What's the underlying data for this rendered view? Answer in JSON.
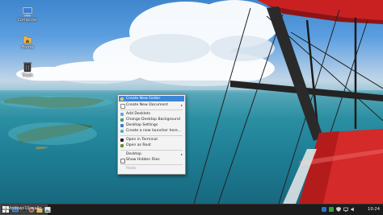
{
  "desktop": {
    "icons": [
      {
        "label": "Computer",
        "icon": "computer-icon"
      },
      {
        "label": "Home",
        "icon": "home-folder-icon"
      },
      {
        "label": "Trash",
        "icon": "trash-icon"
      }
    ]
  },
  "context_menu": {
    "items": [
      {
        "label": "Create New Folder",
        "icon": "folder-new-icon",
        "highlighted": true
      },
      {
        "label": "Create New Document",
        "icon": "document-new-icon",
        "submenu": true
      },
      {
        "label": "Add Desklets",
        "icon": "desklet-icon"
      },
      {
        "label": "Change Desktop Background",
        "icon": "background-icon"
      },
      {
        "label": "Desktop Settings",
        "icon": "settings-icon"
      },
      {
        "label": "Create a new launcher here...",
        "icon": "launcher-icon"
      },
      {
        "label": "Open in Terminal",
        "icon": "terminal-icon"
      },
      {
        "label": "Open as Root",
        "icon": "root-icon"
      },
      {
        "label": "Desktop",
        "icon": "",
        "submenu": true
      },
      {
        "label": "Show Hidden Files",
        "icon": "checkbox-icon"
      },
      {
        "label": "Paste",
        "icon": "",
        "disabled": true
      }
    ]
  },
  "taskbar": {
    "task_label": "[Windows10-wallp...",
    "clock": "10:24"
  },
  "colors": {
    "menu_highlight": "#3b86d8",
    "taskbar_bg": "#1c1c1c",
    "wing_red": "#d42a2a"
  }
}
